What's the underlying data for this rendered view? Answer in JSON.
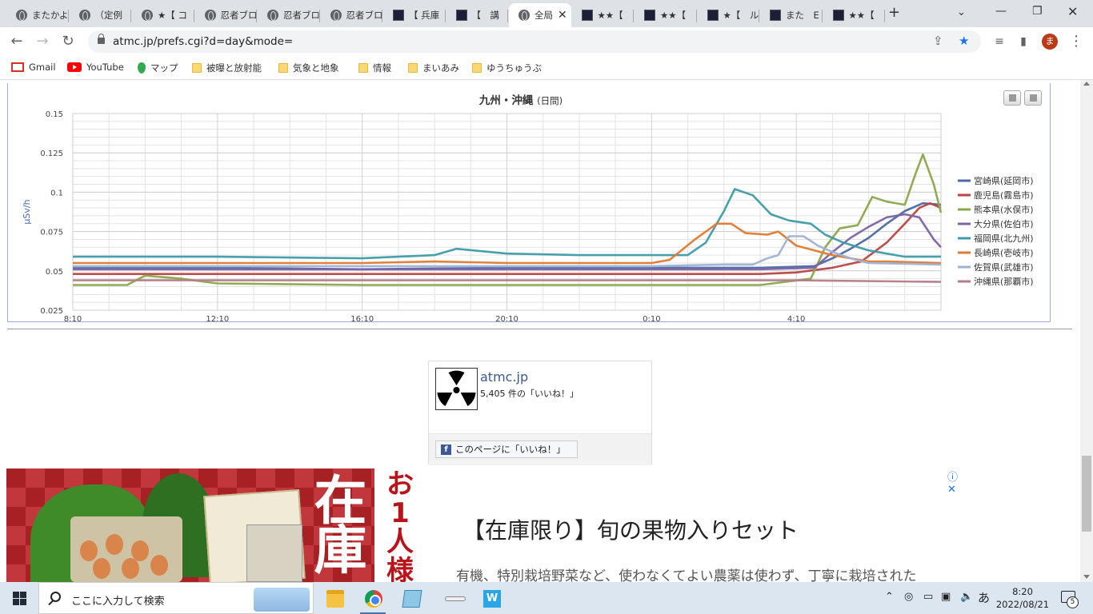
{
  "browser": {
    "tabs": [
      {
        "title": "またかよ",
        "icon": "globe-icon"
      },
      {
        "title": "（定例",
        "icon": "globe-icon"
      },
      {
        "title": "★【 コ",
        "icon": "globe-icon"
      },
      {
        "title": "忍者ブロ",
        "icon": "globe-icon"
      },
      {
        "title": "忍者ブロ",
        "icon": "globe-icon"
      },
      {
        "title": "忍者ブロ",
        "icon": "globe-icon"
      },
      {
        "title": "【 兵庫",
        "icon": "site-icon"
      },
      {
        "title": "【　講",
        "icon": "site-icon"
      },
      {
        "title": "全局",
        "icon": "globe-icon",
        "active": true
      },
      {
        "title": "★★【",
        "icon": "site-icon"
      },
      {
        "title": "★★【",
        "icon": "site-icon"
      },
      {
        "title": "★【　ル",
        "icon": "site-icon"
      },
      {
        "title": "また　E",
        "icon": "site-icon"
      },
      {
        "title": "★★【",
        "icon": "site-icon"
      }
    ],
    "new_tab": "+",
    "tab_close": "✕",
    "url": "atmc.jp/prefs.cgi?d=day&mode=",
    "profile_initial": "ま",
    "bookmarks": [
      {
        "label": "Gmail",
        "icon": "gmail-icon"
      },
      {
        "label": "YouTube",
        "icon": "youtube-icon"
      },
      {
        "label": "マップ",
        "icon": "maps-icon"
      },
      {
        "label": "被曝と放射能",
        "icon": "folder-icon"
      },
      {
        "label": "気象と地象",
        "icon": "folder-icon"
      },
      {
        "label": "情報",
        "icon": "folder-icon"
      },
      {
        "label": "まいあみ",
        "icon": "folder-icon"
      },
      {
        "label": "ゆうちゅうぶ",
        "icon": "folder-icon"
      }
    ]
  },
  "chart": {
    "title": "九州・沖縄",
    "title_suffix": "(日間)"
  },
  "chart_data": {
    "type": "line",
    "title": "九州・沖縄 (日間)",
    "ylabel": "μSv/h",
    "ylim": [
      0.025,
      0.15
    ],
    "yticks": [
      0.025,
      0.05,
      0.075,
      0.1,
      0.125,
      0.15
    ],
    "ytick_labels": [
      "0.025",
      "0.05",
      "0.075",
      "0.1",
      "0.125",
      "0.15"
    ],
    "xlim": [
      0,
      24
    ],
    "xticks": [
      0,
      4,
      8,
      12,
      16,
      20
    ],
    "xtick_labels": [
      "8:10",
      "12:10",
      "16:10",
      "20:10",
      "0:10",
      "4:10"
    ],
    "x_unit": "hours since 8:10",
    "grid": true,
    "legend": "right",
    "series": [
      {
        "name": "宮崎県(延岡市)",
        "color": "#4a6aa5",
        "points": [
          [
            0,
            0.052
          ],
          [
            4,
            0.052
          ],
          [
            8,
            0.051
          ],
          [
            12,
            0.052
          ],
          [
            16,
            0.052
          ],
          [
            19,
            0.052
          ],
          [
            20.5,
            0.053
          ],
          [
            21,
            0.058
          ],
          [
            21.5,
            0.064
          ],
          [
            22,
            0.071
          ],
          [
            22.5,
            0.08
          ],
          [
            23,
            0.088
          ],
          [
            23.5,
            0.093
          ],
          [
            24,
            0.092
          ]
        ]
      },
      {
        "name": "鹿児島(霧島市)",
        "color": "#b94545",
        "points": [
          [
            0,
            0.048
          ],
          [
            4,
            0.048
          ],
          [
            8,
            0.048
          ],
          [
            12,
            0.048
          ],
          [
            16,
            0.048
          ],
          [
            19,
            0.048
          ],
          [
            20,
            0.049
          ],
          [
            21,
            0.052
          ],
          [
            21.8,
            0.056
          ],
          [
            22.5,
            0.068
          ],
          [
            23,
            0.08
          ],
          [
            23.4,
            0.09
          ],
          [
            23.7,
            0.093
          ],
          [
            24,
            0.09
          ]
        ]
      },
      {
        "name": "熊本県(水俣市)",
        "color": "#8aa84a",
        "points": [
          [
            0,
            0.041
          ],
          [
            1.5,
            0.041
          ],
          [
            2,
            0.047
          ],
          [
            3,
            0.045
          ],
          [
            4,
            0.042
          ],
          [
            8,
            0.041
          ],
          [
            12,
            0.041
          ],
          [
            16,
            0.041
          ],
          [
            19,
            0.041
          ],
          [
            20.4,
            0.045
          ],
          [
            20.8,
            0.065
          ],
          [
            21.2,
            0.077
          ],
          [
            21.7,
            0.079
          ],
          [
            22.1,
            0.097
          ],
          [
            22.5,
            0.094
          ],
          [
            23,
            0.092
          ],
          [
            23.3,
            0.112
          ],
          [
            23.5,
            0.124
          ],
          [
            23.8,
            0.105
          ],
          [
            24,
            0.087
          ]
        ]
      },
      {
        "name": "大分県(佐伯市)",
        "color": "#7c63a6",
        "points": [
          [
            0,
            0.051
          ],
          [
            4,
            0.051
          ],
          [
            8,
            0.051
          ],
          [
            12,
            0.051
          ],
          [
            16,
            0.051
          ],
          [
            19,
            0.051
          ],
          [
            20.5,
            0.052
          ],
          [
            21,
            0.062
          ],
          [
            21.5,
            0.071
          ],
          [
            22,
            0.078
          ],
          [
            22.5,
            0.084
          ],
          [
            23,
            0.086
          ],
          [
            23.4,
            0.084
          ],
          [
            23.8,
            0.07
          ],
          [
            24,
            0.065
          ]
        ]
      },
      {
        "name": "福岡県(北九州)",
        "color": "#3e9ba9",
        "points": [
          [
            0,
            0.059
          ],
          [
            4,
            0.059
          ],
          [
            8,
            0.058
          ],
          [
            10,
            0.06
          ],
          [
            10.6,
            0.064
          ],
          [
            12,
            0.061
          ],
          [
            14,
            0.06
          ],
          [
            16,
            0.06
          ],
          [
            17,
            0.06
          ],
          [
            17.5,
            0.068
          ],
          [
            18,
            0.088
          ],
          [
            18.3,
            0.102
          ],
          [
            18.8,
            0.098
          ],
          [
            19.3,
            0.086
          ],
          [
            19.8,
            0.082
          ],
          [
            20.4,
            0.08
          ],
          [
            20.8,
            0.073
          ],
          [
            21.3,
            0.068
          ],
          [
            22,
            0.063
          ],
          [
            22.5,
            0.061
          ],
          [
            23,
            0.059
          ],
          [
            24,
            0.059
          ]
        ]
      },
      {
        "name": "長崎県(壱岐市)",
        "color": "#e07a30",
        "points": [
          [
            0,
            0.055
          ],
          [
            4,
            0.055
          ],
          [
            8,
            0.055
          ],
          [
            10,
            0.056
          ],
          [
            12,
            0.055
          ],
          [
            16,
            0.055
          ],
          [
            16.5,
            0.057
          ],
          [
            17.2,
            0.07
          ],
          [
            17.8,
            0.08
          ],
          [
            18.2,
            0.08
          ],
          [
            18.6,
            0.074
          ],
          [
            19.2,
            0.073
          ],
          [
            19.5,
            0.075
          ],
          [
            20,
            0.066
          ],
          [
            21,
            0.06
          ],
          [
            21.5,
            0.058
          ],
          [
            22,
            0.056
          ],
          [
            22.5,
            0.056
          ],
          [
            24,
            0.055
          ]
        ]
      },
      {
        "name": "佐賀県(武雄市)",
        "color": "#9fb2d4",
        "points": [
          [
            0,
            0.053
          ],
          [
            4,
            0.053
          ],
          [
            8,
            0.053
          ],
          [
            12,
            0.053
          ],
          [
            16,
            0.053
          ],
          [
            18,
            0.054
          ],
          [
            18.8,
            0.054
          ],
          [
            19.2,
            0.058
          ],
          [
            19.5,
            0.06
          ],
          [
            19.8,
            0.072
          ],
          [
            20.2,
            0.072
          ],
          [
            20.6,
            0.066
          ],
          [
            21,
            0.062
          ],
          [
            21.5,
            0.058
          ],
          [
            22,
            0.055
          ],
          [
            24,
            0.054
          ]
        ]
      },
      {
        "name": "沖縄県(那覇市)",
        "color": "#b47c87",
        "points": [
          [
            0,
            0.044
          ],
          [
            4,
            0.044
          ],
          [
            8,
            0.044
          ],
          [
            12,
            0.044
          ],
          [
            16,
            0.044
          ],
          [
            20,
            0.044
          ],
          [
            24,
            0.043
          ]
        ]
      }
    ]
  },
  "facebook": {
    "page_name": "atmc.jp",
    "likes": "5,405 件の「いいね！」",
    "like_button": "このページに「いいね！」"
  },
  "ad": {
    "image_text": "在庫",
    "promo_text": "お1人様",
    "title": "【在庫限り】旬の果物入りセット",
    "description": "有機、特別栽培野菜など、使わなくてよい農薬は使わず、丁寧に栽培された"
  },
  "taskbar": {
    "search_placeholder": "ここに入力して検索",
    "ime": "あ",
    "time": "8:20",
    "date": "2022/08/21",
    "notifications": "5"
  }
}
